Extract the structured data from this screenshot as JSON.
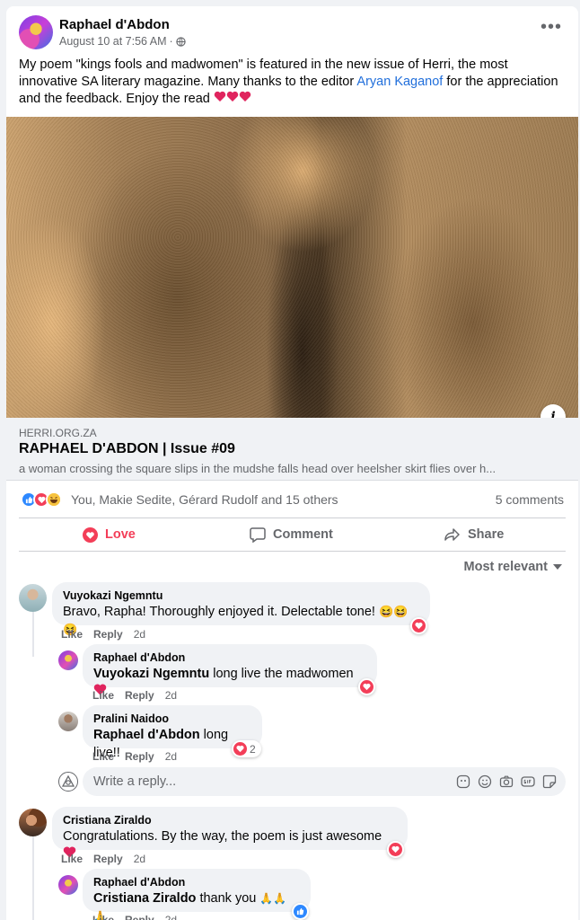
{
  "post": {
    "author": "Raphael d'Abdon",
    "timestamp": "August 10 at 7:56 AM",
    "audience_separator": "·",
    "text_part1": "My poem \"kings fools and madwomen\" is featured in the new issue of Herri, the most innovative SA literary magazine. Many thanks to the editor ",
    "mention": "Aryan Kaganof",
    "text_part2": " for the appreciation and the feedback. Enjoy the read"
  },
  "link_preview": {
    "domain": "HERRI.ORG.ZA",
    "title": "RAPHAEL D'ABDON | Issue #09",
    "description": "a woman crossing the square slips in the mudshe falls head over heelsher skirt flies over h..."
  },
  "reactions": {
    "summary": "You, Makie Sedite, Gérard Rudolf and 15 others",
    "comments_count": "5 comments"
  },
  "actions": {
    "love": "Love",
    "comment": "Comment",
    "share": "Share"
  },
  "sort_label": "Most relevant",
  "comment_actions": {
    "like": "Like",
    "reply": "Reply"
  },
  "comments": [
    {
      "name": "Vuyokazi Ngemntu",
      "text": "Bravo, Rapha! Thoroughly enjoyed it. Delectable tone!",
      "emojis": "😆😆😆",
      "time": "2d"
    },
    {
      "name": "Raphael d'Abdon",
      "mention": "Vuyokazi Ngemntu",
      "text": " long live the madwomen",
      "time": "2d"
    },
    {
      "name": "Pralini Naidoo",
      "mention": "Raphael d'Abdon",
      "text": " long live!!",
      "time": "2d",
      "reaction_count": "2"
    },
    {
      "name": "Cristiana Ziraldo",
      "text": "Congratulations. By the way, the poem is just awesome",
      "time": "2d"
    },
    {
      "name": "Raphael d'Abdon",
      "mention": "Cristiana Ziraldo",
      "text": " thank you",
      "emojis": "🙏🙏🙏",
      "time": "2d"
    }
  ],
  "reply_placeholder": "Write a reply...",
  "colors": {
    "love": "#f33e58",
    "link": "#216fdb",
    "like": "#2d88ff",
    "secondary_text": "#65676b"
  }
}
